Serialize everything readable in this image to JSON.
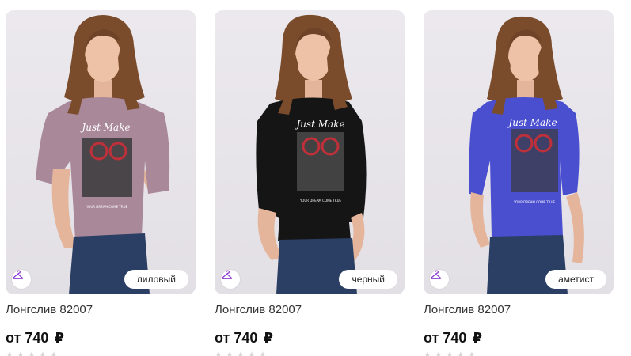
{
  "products": [
    {
      "title": "Лонгслив 82007",
      "price_prefix": "от",
      "price_value": "740",
      "currency": "₽",
      "color_label": "лиловый",
      "shirt_color": "#a9889a",
      "print_text": "Just Make",
      "print_small": "YOUR DREAM COME TRUE",
      "hanger_icon": "hanger-icon"
    },
    {
      "title": "Лонгслив 82007",
      "price_prefix": "от",
      "price_value": "740",
      "currency": "₽",
      "color_label": "черный",
      "shirt_color": "#151515",
      "print_text": "Just Make",
      "print_small": "YOUR DREAM COME TRUE",
      "hanger_icon": "hanger-icon"
    },
    {
      "title": "Лонгслив 82007",
      "price_prefix": "от",
      "price_value": "740",
      "currency": "₽",
      "color_label": "аметист",
      "shirt_color": "#4a4fd0",
      "print_text": "Just Make",
      "print_small": "YOUR DREAM COME TRUE",
      "hanger_icon": "hanger-icon"
    }
  ],
  "colors": {
    "accent": "#8a3fd1",
    "background": "#ffffff",
    "card_bg": "#e8e5ea"
  }
}
